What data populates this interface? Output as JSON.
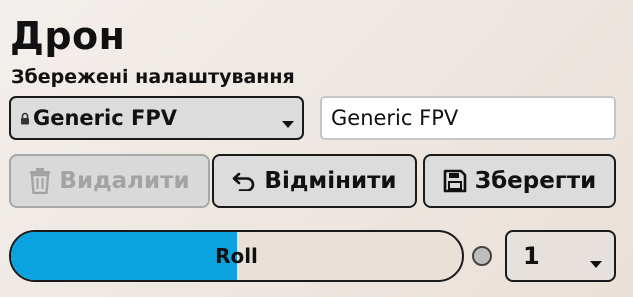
{
  "header": {
    "title": "Дрон",
    "subtitle": "Збережені налаштування"
  },
  "preset": {
    "selected": "Generic FPV",
    "locked": true,
    "name_value": "Generic FPV"
  },
  "actions": {
    "delete_label": "Видалити",
    "delete_enabled": false,
    "undo_label": "Відмінити",
    "save_label": "Зберегти"
  },
  "control": {
    "slider_label": "Roll",
    "slider_level": 0.5,
    "channel_value": "1"
  },
  "colors": {
    "accent": "#0aa3e0",
    "button_bg": "#dcdcdc",
    "disabled_text": "#a3a3a3"
  },
  "icons": {
    "preset_lock": "lock-icon",
    "delete": "trash-icon",
    "undo": "undo-icon",
    "save": "floppy-disk-icon",
    "dropdown": "caret-down-icon"
  }
}
